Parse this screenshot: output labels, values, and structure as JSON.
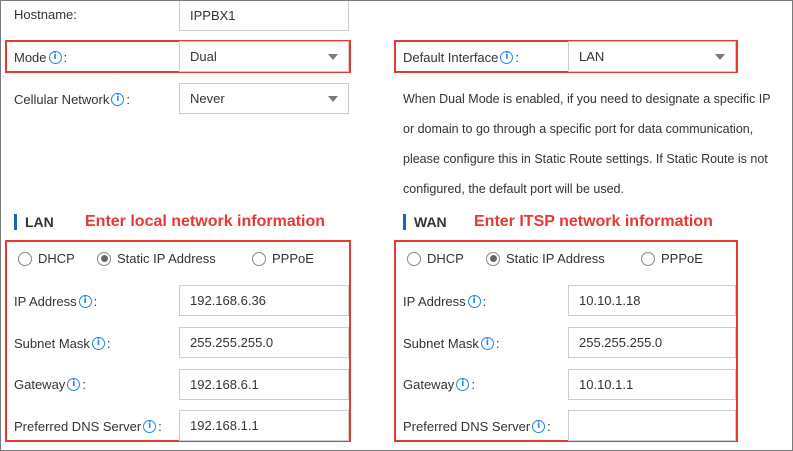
{
  "general": {
    "hostname_label": "Hostname:",
    "hostname_value": "IPPBX1",
    "mode_label": "Mode",
    "mode_value": "Dual",
    "cellular_label": "Cellular Network",
    "cellular_value": "Never",
    "default_interface_label": "Default Interface",
    "default_interface_value": "LAN",
    "colon": ":",
    "dual_mode_note": [
      "When Dual Mode is enabled, if you need to designate a specific IP",
      "or domain to go through a specific port for data communication,",
      "please configure this in Static Route settings. If Static Route is not",
      "configured, the default port will be used."
    ]
  },
  "lan": {
    "title": "LAN",
    "annotation": "Enter local network information",
    "radio_dhcp": "DHCP",
    "radio_static": "Static IP Address",
    "radio_pppoe": "PPPoE",
    "selected": "Static IP Address",
    "ip_label": "IP Address",
    "ip_value": "192.168.6.36",
    "subnet_label": "Subnet Mask",
    "subnet_value": "255.255.255.0",
    "gateway_label": "Gateway",
    "gateway_value": "192.168.6.1",
    "dns_label": "Preferred DNS Server",
    "dns_value": "192.168.1.1"
  },
  "wan": {
    "title": "WAN",
    "annotation": "Enter ITSP network information",
    "radio_dhcp": "DHCP",
    "radio_static": "Static IP Address",
    "radio_pppoe": "PPPoE",
    "selected": "Static IP Address",
    "ip_label": "IP Address",
    "ip_value": "10.10.1.18",
    "subnet_label": "Subnet Mask",
    "subnet_value": "255.255.255.0",
    "gateway_label": "Gateway",
    "gateway_value": "10.10.1.1",
    "dns_label": "Preferred DNS Server",
    "dns_value": ""
  },
  "colors": {
    "annotation_red": "#e53935",
    "info_blue": "#1e88e5",
    "section_bar": "#1565c0"
  },
  "icons": {
    "info": "info-circle-icon",
    "dropdown": "chevron-down-icon"
  }
}
